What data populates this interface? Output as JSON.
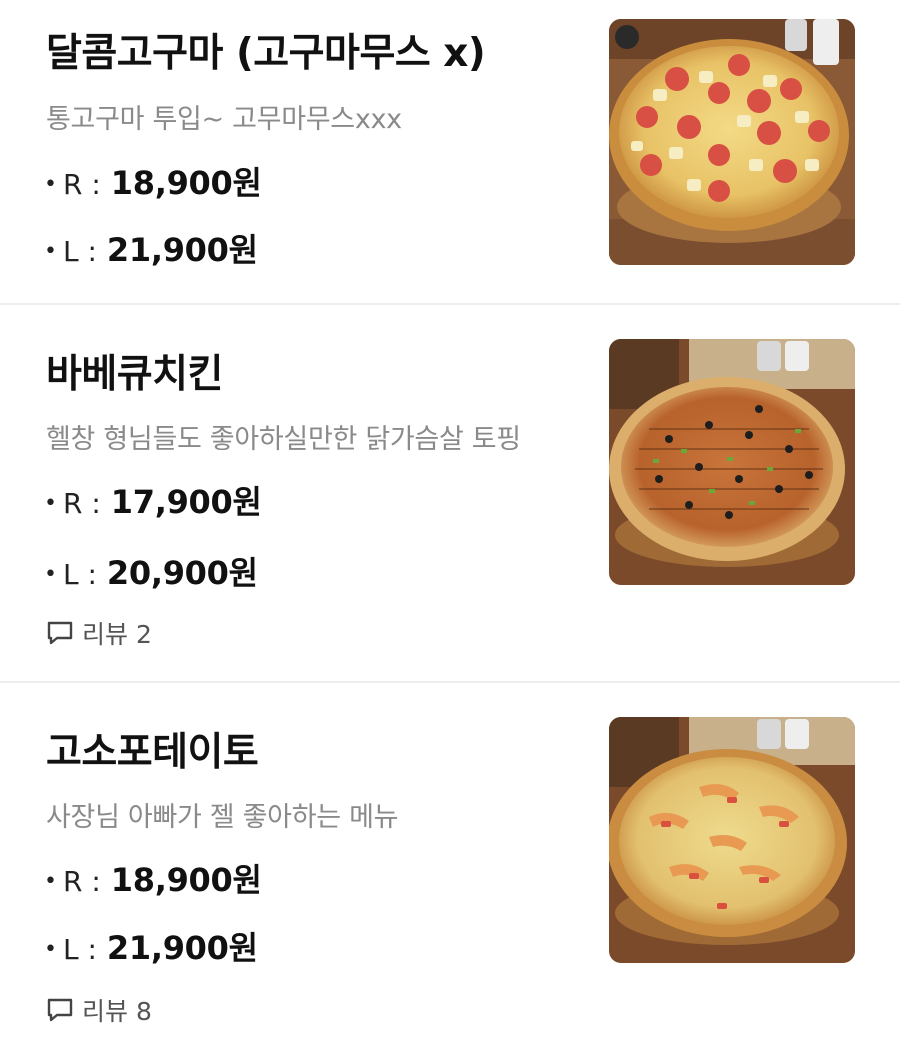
{
  "items": [
    {
      "name": "달콤고구마 (고구마무스 x)",
      "description": "통고구마 투입~ 고무마무스xxx",
      "price_r_label": "R :",
      "price_r": "18,900원",
      "price_l_label": "L :",
      "price_l": "21,900원",
      "review": null,
      "image": "sweet-potato-pizza-photo"
    },
    {
      "name": "바베큐치킨",
      "description": "헬창 형님들도 좋아하실만한 닭가슴살 토핑",
      "price_r_label": "R :",
      "price_r": "17,900원",
      "price_l_label": "L :",
      "price_l": "20,900원",
      "review": "리뷰 2",
      "image": "bbq-chicken-pizza-photo"
    },
    {
      "name": "고소포테이토",
      "description": "사장님 아빠가 젤 좋아하는 메뉴",
      "price_r_label": "R :",
      "price_r": "18,900원",
      "price_l_label": "L :",
      "price_l": "21,900원",
      "review": "리뷰 8",
      "image": "potato-pizza-photo"
    }
  ],
  "colors": {
    "title": "#111111",
    "description": "#8a8a8a",
    "divider": "#eeeeee",
    "background": "#ffffff"
  },
  "icons": {
    "review": "comment-icon",
    "bullet": "•"
  }
}
